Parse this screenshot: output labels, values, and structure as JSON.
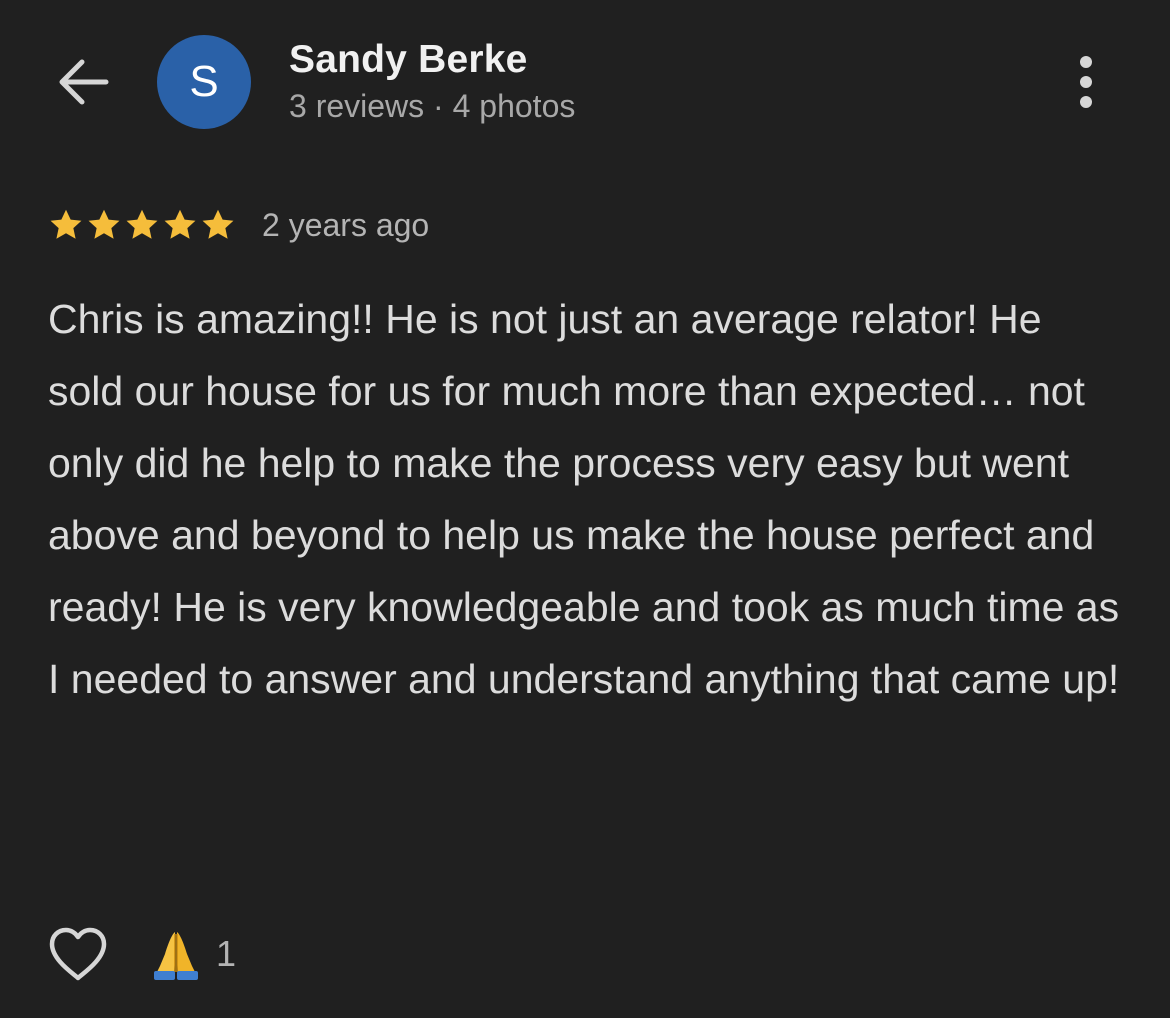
{
  "header": {
    "back_icon": "arrow-back-icon",
    "avatar_initial": "S",
    "avatar_color": "#2a61a8",
    "reviewer_name": "Sandy Berke",
    "reviewer_meta": "3 reviews · 4 photos",
    "menu_icon": "more-vertical-icon"
  },
  "review": {
    "rating": 5,
    "rating_max": 5,
    "star_color": "#f5bd3b",
    "date": "2 years ago",
    "text": "Chris is amazing!! He is not just an average relator! He sold our house for us for much more than expected… not only did he help to make the process very easy but went above and beyond to help us make the house perfect and ready! He is very knowledgeable and took as much time as I needed to answer and understand anything that came up!"
  },
  "actions": {
    "like_icon": "heart-outline-icon",
    "reaction_icon": "folded-hands-icon",
    "reaction_count": "1"
  }
}
